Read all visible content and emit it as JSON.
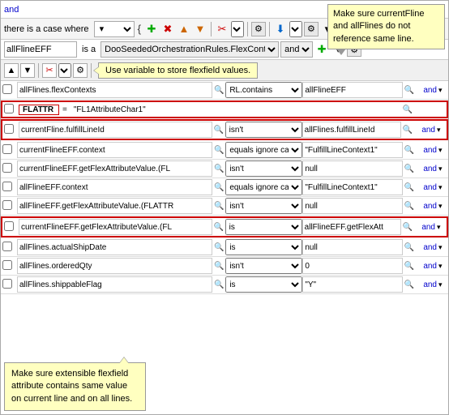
{
  "topbar": {
    "text": "and"
  },
  "toolbar": {
    "condition_label": "there is a case where",
    "bracket_open": "{",
    "bracket_close": "}",
    "and_label": "and"
  },
  "second_toolbar": {
    "field": "allFlineEFF",
    "is_a": "is a",
    "context": "DooSeededOrchestrationRules.FlexContext",
    "and": "and"
  },
  "tooltip_tr": {
    "line1": "Make sure currentFline",
    "line2": "and allFlines do not",
    "line3": "reference same line."
  },
  "actions_tooltip": "Use variable to store flexfield values.",
  "rows": [
    {
      "id": 1,
      "field": "allFlines.flexContexts",
      "operator": "RL.contains",
      "value": "allFlineEFF",
      "and_text": "and",
      "highlighted": false,
      "show_search": true
    },
    {
      "id": 2,
      "field": "FLATTR",
      "equals": "=",
      "value": "\"FL1AttributeChar1\"",
      "highlighted": true,
      "is_flattr": true
    },
    {
      "id": 3,
      "field": "currentFline.fulfillLineId",
      "operator": "isn't",
      "value": "allFlines.fulfillLineId",
      "and_text": "and",
      "highlighted": false,
      "show_search": true,
      "highlighted_border": true
    },
    {
      "id": 4,
      "field": "currentFlineEFF.context",
      "operator": "equals ignore case",
      "value": "\"FulfillLineContext1\"",
      "and_text": "and",
      "highlighted": false,
      "show_search": true
    },
    {
      "id": 5,
      "field": "currentFlineEFF.getFlexAttributeValue.(FL",
      "operator": "isn't",
      "value": "null",
      "and_text": "and",
      "highlighted": false,
      "show_search": true
    },
    {
      "id": 6,
      "field": "allFlineEFF.context",
      "operator": "equals ignore case",
      "value": "\"FulfillLineContext1\"",
      "and_text": "and",
      "highlighted": false,
      "show_search": true
    },
    {
      "id": 7,
      "field": "allFlineEFF.getFlexAttributeValue.(FLATTR",
      "operator": "isn't",
      "value": "null",
      "and_text": "and",
      "highlighted": false,
      "show_search": true
    },
    {
      "id": 8,
      "field": "currentFlineEFF.getFlexAttributeValue.(FL",
      "operator": "is",
      "value": "allFlineEFF.getFlexAtt",
      "and_text": "and",
      "highlighted": true,
      "show_search": true
    },
    {
      "id": 9,
      "field": "allFlines.actualShipDate",
      "operator": "is",
      "value": "null",
      "and_text": "and",
      "highlighted": false,
      "show_search": true
    },
    {
      "id": 10,
      "field": "allFlines.orderedQty",
      "operator": "isn't",
      "value": "0",
      "and_text": "and",
      "highlighted": false,
      "show_search": true
    },
    {
      "id": 11,
      "field": "allFlines.shippableFlag",
      "operator": "is",
      "value": "\"Y\"",
      "and_text": "and",
      "highlighted": false,
      "show_search": true
    }
  ],
  "bottom_tooltip": {
    "line1": "Make sure extensible flexfield",
    "line2": "attribute contains same value",
    "line3": "on current line and on all lines."
  },
  "icons": {
    "up_arrow": "▲",
    "down_arrow": "▼",
    "cut": "✂",
    "copy": "⧉",
    "paste": "📋",
    "add": "+",
    "delete": "✕",
    "search": "🔍",
    "gear": "⚙",
    "chevron_down": "▾",
    "check": "✓"
  }
}
